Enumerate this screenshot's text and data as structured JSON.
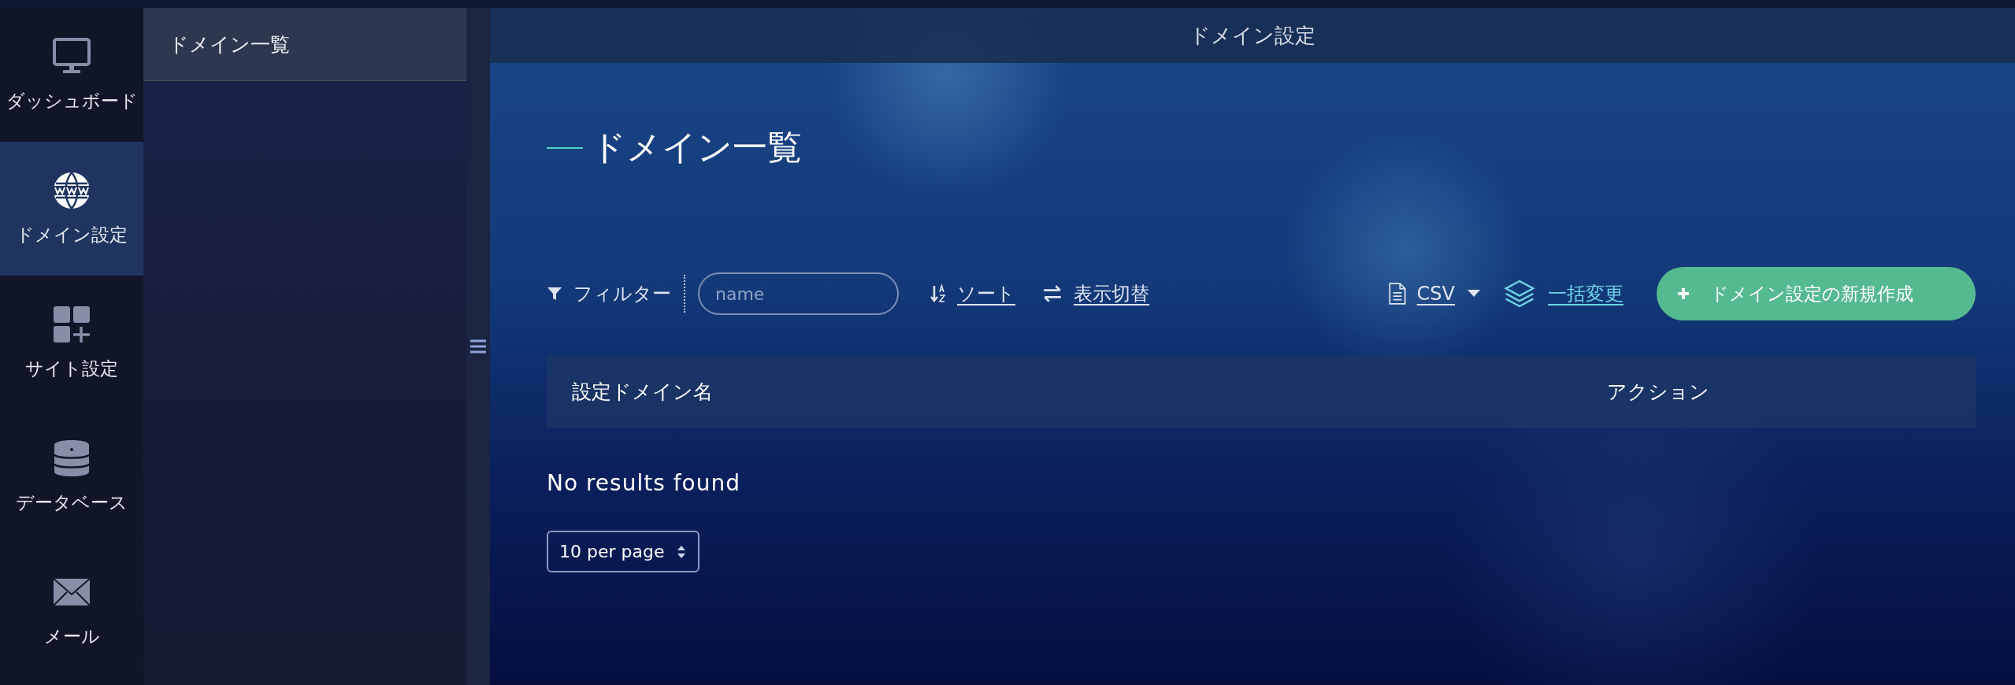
{
  "nav": [
    {
      "label": "ダッシュボード",
      "kind": "monitor",
      "selected": false
    },
    {
      "label": "ドメイン設定",
      "kind": "globe",
      "selected": true
    },
    {
      "label": "サイト設定",
      "kind": "grid-plus",
      "selected": false
    },
    {
      "label": "データベース",
      "kind": "database",
      "selected": false
    },
    {
      "label": "メール",
      "kind": "mail",
      "selected": false
    }
  ],
  "subnav": [
    {
      "label": "ドメイン一覧",
      "selected": true
    }
  ],
  "page_title": "ドメイン設定",
  "heading": "ドメイン一覧",
  "toolbar": {
    "filter_label": "フィルター",
    "search": {
      "placeholder": "name"
    },
    "sort": "ソート",
    "view_toggle": "表示切替",
    "csv": "CSV",
    "bulk_edit": "一括変更",
    "create_button": "ドメイン設定の新規作成"
  },
  "table": {
    "columns": [
      "設定ドメイン名",
      "アクション"
    ],
    "empty_message": "No results found"
  },
  "per_page": "10 per page"
}
